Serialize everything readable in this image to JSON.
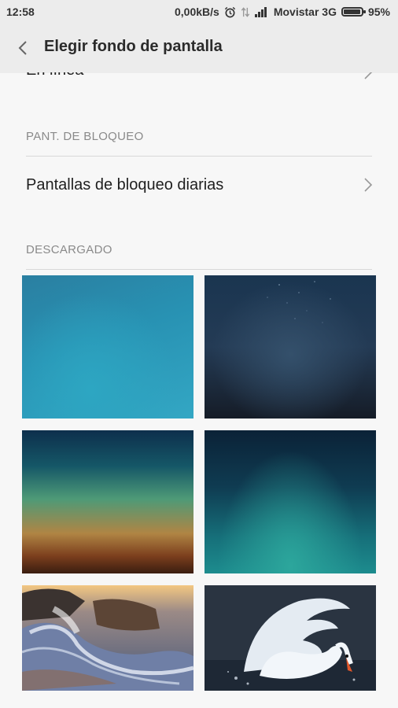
{
  "status_bar": {
    "time": "12:58",
    "network_speed": "0,00kB/s",
    "carrier": "Movistar 3G",
    "battery": "95%",
    "battery_level": 0.95,
    "icons": [
      "alarm-icon",
      "data-transfer-icon",
      "signal-icon",
      "battery-icon"
    ]
  },
  "header": {
    "title": "Elegir fondo de pantalla"
  },
  "list": {
    "online_label": "En línea",
    "lock_section": "PANT. DE BLOQUEO",
    "lock_item": "Pantallas de bloqueo diarias",
    "downloaded_section": "DESCARGADO"
  },
  "wallpapers": [
    {
      "name": "teal-blue-gradient"
    },
    {
      "name": "dark-night-sky"
    },
    {
      "name": "sunset-gradient"
    },
    {
      "name": "deep-teal-gradient"
    },
    {
      "name": "ocean-waves-rocks"
    },
    {
      "name": "white-swan"
    }
  ],
  "colors": {
    "background": "#f7f7f7",
    "header": "#ececec",
    "section_text": "#8a8a8a"
  }
}
